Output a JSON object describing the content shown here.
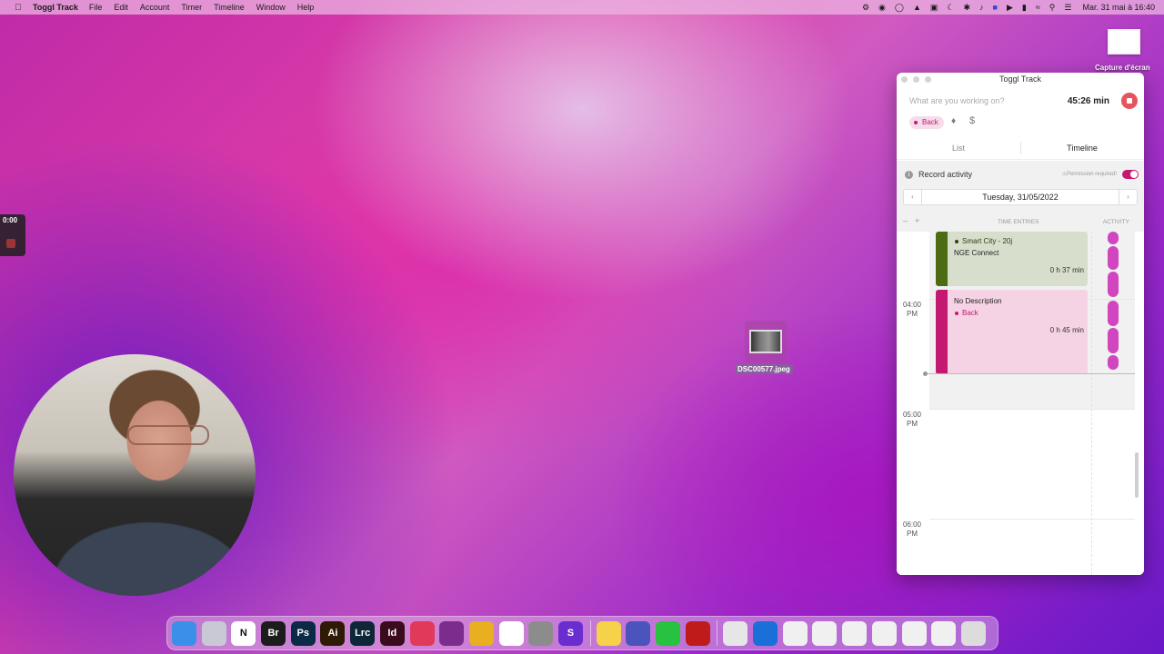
{
  "menubar": {
    "app_name": "Toggl Track",
    "menus": [
      "File",
      "Edit",
      "Account",
      "Timer",
      "Timeline",
      "Window",
      "Help"
    ],
    "datetime": "Mar. 31 mai à  16:40"
  },
  "desktop": {
    "capture_label": "Capture d'écran",
    "file_name": "DSC00577.jpeg",
    "mini_timer": "0:00"
  },
  "toggl": {
    "window_title": "Toggl Track",
    "entry_placeholder": "What are you working on?",
    "timer": "45:26 min",
    "project_tag": "Back",
    "tabs": [
      "List",
      "Timeline"
    ],
    "record_activity": "Record activity",
    "permission": "Permission required!",
    "date": "Tuesday, 31/05/2022",
    "col_time_entries": "TIME ENTRIES",
    "col_activity": "ACTIVITY",
    "hours": [
      {
        "h": "04:00",
        "ap": "PM"
      },
      {
        "h": "05:00",
        "ap": "PM"
      },
      {
        "h": "06:00",
        "ap": "PM"
      }
    ],
    "entries": [
      {
        "description": "NGE Connect",
        "project": "Smart City - 20j",
        "duration": "0 h 37 min",
        "color": "#4c6b12"
      },
      {
        "description": "No Description",
        "project": "Back",
        "duration": "0 h 45 min",
        "color": "#c41970"
      }
    ]
  },
  "dock": {
    "apps": [
      {
        "name": "finder-icon",
        "label": "",
        "color": "#3a8fe8"
      },
      {
        "name": "launchpad-icon",
        "label": "",
        "color": "#c9c9d6"
      },
      {
        "name": "notion-icon",
        "label": "N",
        "color": "#ffffff"
      },
      {
        "name": "bridge-icon",
        "label": "Br",
        "color": "#1c1c1c"
      },
      {
        "name": "photoshop-icon",
        "label": "Ps",
        "color": "#0b2a45"
      },
      {
        "name": "illustrator-icon",
        "label": "Ai",
        "color": "#2e1a05"
      },
      {
        "name": "lightroom-classic-icon",
        "label": "Lrc",
        "color": "#0d2638"
      },
      {
        "name": "indesign-icon",
        "label": "Id",
        "color": "#3a0b1c"
      },
      {
        "name": "toggl-icon",
        "label": "",
        "color": "#e0395a"
      },
      {
        "name": "power-icon",
        "label": "",
        "color": "#7a2d8c"
      },
      {
        "name": "chrome-icon",
        "label": "",
        "color": "#e8b020"
      },
      {
        "name": "slack-icon",
        "label": "",
        "color": "#ffffff"
      },
      {
        "name": "system-preferences-icon",
        "label": "",
        "color": "#8c8c8c"
      },
      {
        "name": "s-app-icon",
        "label": "S",
        "color": "#6a2ed0"
      },
      {
        "name": "notes-icon",
        "label": "",
        "color": "#f5d24a"
      },
      {
        "name": "teams-icon",
        "label": "",
        "color": "#4b53bc"
      },
      {
        "name": "whatsapp-icon",
        "label": "",
        "color": "#27c240"
      },
      {
        "name": "acrobat-icon",
        "label": "",
        "color": "#c01b1b"
      },
      {
        "name": "printer-icon",
        "label": "",
        "color": "#e6e6e6"
      },
      {
        "name": "onepassword-icon",
        "label": "",
        "color": "#1a6fd8"
      },
      {
        "name": "document-thumb-1-icon",
        "label": "",
        "color": "#f0f0f0"
      },
      {
        "name": "document-thumb-2-icon",
        "label": "",
        "color": "#f0f0f0"
      },
      {
        "name": "document-thumb-3-icon",
        "label": "",
        "color": "#f0f0f0"
      },
      {
        "name": "document-thumb-4-icon",
        "label": "",
        "color": "#f0f0f0"
      },
      {
        "name": "document-thumb-5-icon",
        "label": "",
        "color": "#f0f0f0"
      },
      {
        "name": "document-thumb-6-icon",
        "label": "",
        "color": "#f0f0f0"
      },
      {
        "name": "trash-icon",
        "label": "",
        "color": "#dcdcdc"
      }
    ]
  }
}
